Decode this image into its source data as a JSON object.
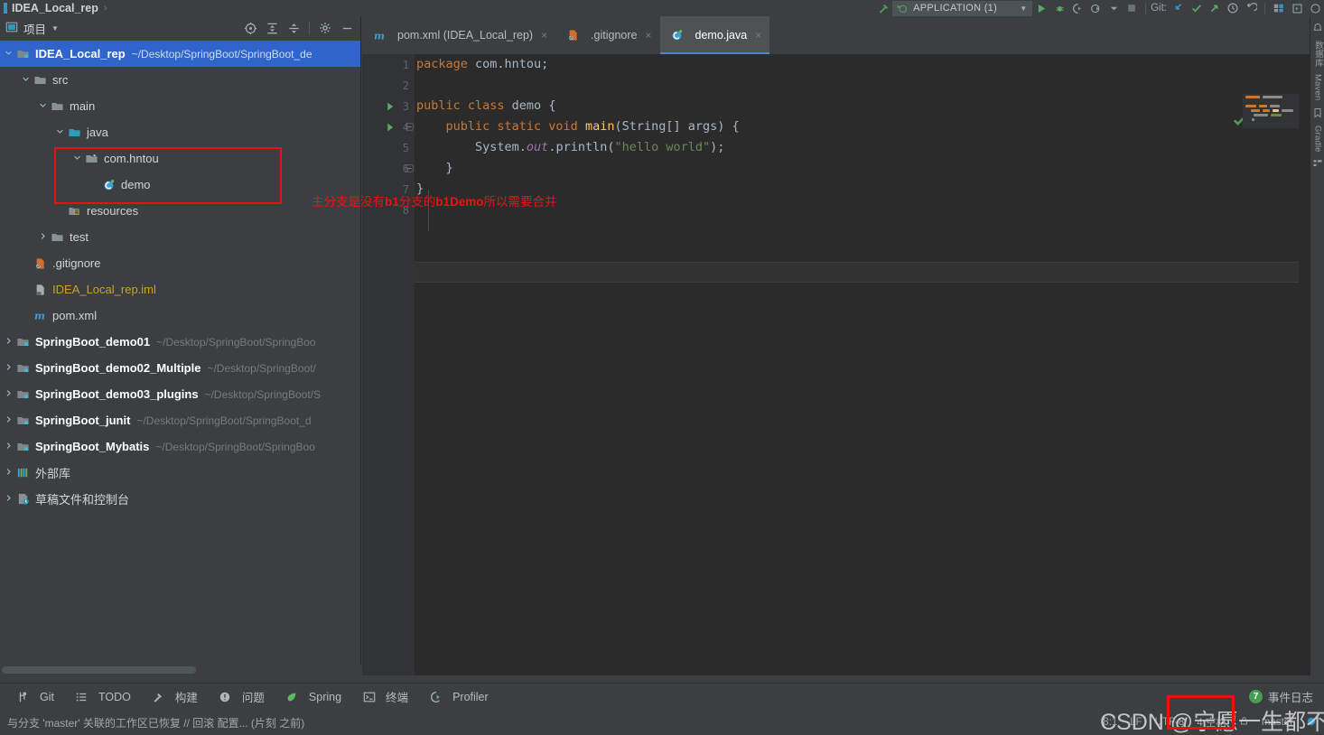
{
  "topbar": {
    "breadcrumb": "IDEA_Local_rep",
    "breadcrumb_sep": "›",
    "run_config": "APPLICATION (1)",
    "run_config_caret": "▼",
    "icons": [
      "hammer-icon",
      "run-config-icon",
      "run-icon",
      "debug-icon",
      "run-with-coverage-icon",
      "profile-icon",
      "stop-icon"
    ],
    "git_label": "Git:",
    "git_icons": [
      "update-project-icon",
      "commit-icon",
      "push-icon",
      "history-icon",
      "rollback-icon"
    ],
    "trailing_icons": [
      "search-everywhere-icon",
      "settings-icon"
    ]
  },
  "project_panel": {
    "title": "项目",
    "caret": "▼",
    "actions": [
      "select-opened-file-icon",
      "expand-all-icon",
      "collapse-all-icon",
      "settings-gear-icon",
      "hide-icon"
    ],
    "tree": [
      {
        "depth": 0,
        "arrow": "down",
        "icon": "module-icon",
        "label": "IDEA_Local_rep",
        "bold": true,
        "path": "~/Desktop/SpringBoot/SpringBoot_de",
        "selected": true
      },
      {
        "depth": 1,
        "arrow": "down",
        "icon": "folder-icon",
        "label": "src",
        "bold": false,
        "path": ""
      },
      {
        "depth": 2,
        "arrow": "down",
        "icon": "folder-icon",
        "label": "main",
        "bold": false,
        "path": ""
      },
      {
        "depth": 3,
        "arrow": "down",
        "icon": "source-root-icon",
        "label": "java",
        "bold": false,
        "path": ""
      },
      {
        "depth": 4,
        "arrow": "down",
        "icon": "package-icon",
        "label": "com.hntou",
        "bold": false,
        "path": ""
      },
      {
        "depth": 5,
        "arrow": "none",
        "icon": "java-class-icon",
        "label": "demo",
        "bold": false,
        "path": ""
      },
      {
        "depth": 3,
        "arrow": "none",
        "icon": "resource-root-icon",
        "label": "resources",
        "bold": false,
        "path": ""
      },
      {
        "depth": 2,
        "arrow": "right",
        "icon": "folder-icon",
        "label": "test",
        "bold": false,
        "path": ""
      },
      {
        "depth": 1,
        "arrow": "none",
        "icon": "gitignore-icon",
        "label": ".gitignore",
        "bold": false,
        "path": ""
      },
      {
        "depth": 1,
        "arrow": "none",
        "icon": "iml-icon",
        "label": "IDEA_Local_rep.iml",
        "bold": false,
        "path": "",
        "yellow": true
      },
      {
        "depth": 1,
        "arrow": "none",
        "icon": "maven-icon",
        "label": "pom.xml",
        "bold": false,
        "path": ""
      },
      {
        "depth": 0,
        "arrow": "right",
        "icon": "module-icon",
        "label": "SpringBoot_demo01",
        "bold": true,
        "path": "~/Desktop/SpringBoot/SpringBoo"
      },
      {
        "depth": 0,
        "arrow": "right",
        "icon": "module-icon",
        "label": "SpringBoot_demo02_Multiple",
        "bold": true,
        "path": "~/Desktop/SpringBoot/"
      },
      {
        "depth": 0,
        "arrow": "right",
        "icon": "module-icon",
        "label": "SpringBoot_demo03_plugins",
        "bold": true,
        "path": "~/Desktop/SpringBoot/S"
      },
      {
        "depth": 0,
        "arrow": "right",
        "icon": "module-icon",
        "label": "SpringBoot_junit",
        "bold": true,
        "path": "~/Desktop/SpringBoot/SpringBoot_d"
      },
      {
        "depth": 0,
        "arrow": "right",
        "icon": "module-icon",
        "label": "SpringBoot_Mybatis",
        "bold": true,
        "path": "~/Desktop/SpringBoot/SpringBoo"
      },
      {
        "depth": 0,
        "arrow": "right",
        "icon": "external-libraries-icon",
        "label": "外部库",
        "bold": false,
        "path": ""
      },
      {
        "depth": 0,
        "arrow": "right",
        "icon": "scratches-icon",
        "label": "草稿文件和控制台",
        "bold": false,
        "path": ""
      }
    ]
  },
  "editor": {
    "tabs": [
      {
        "label": "pom.xml (IDEA_Local_rep)",
        "icon": "maven-icon",
        "active": false,
        "close": "×"
      },
      {
        "label": ".gitignore",
        "icon": "gitignore-icon",
        "active": false,
        "close": "×"
      },
      {
        "label": "demo.java",
        "icon": "java-class-icon",
        "active": true,
        "close": "×"
      }
    ],
    "line_numbers": [
      "1",
      "2",
      "3",
      "4",
      "5",
      "6",
      "7",
      "8"
    ],
    "code_lines": [
      [
        {
          "t": "package ",
          "c": "k"
        },
        {
          "t": "com.hntou;",
          "c": "pl"
        }
      ],
      [],
      [
        {
          "t": "public class ",
          "c": "k"
        },
        {
          "t": "demo ",
          "c": "cls"
        },
        {
          "t": "{",
          "c": "br"
        }
      ],
      [
        {
          "t": "    public static void ",
          "c": "k"
        },
        {
          "t": "main",
          "c": "fn"
        },
        {
          "t": "(",
          "c": "br"
        },
        {
          "t": "String",
          "c": "cls"
        },
        {
          "t": "[] args",
          "c": "pl"
        },
        {
          "t": ") ",
          "c": "br"
        },
        {
          "t": "{",
          "c": "br"
        }
      ],
      [
        {
          "t": "        System.",
          "c": "pl"
        },
        {
          "t": "out",
          "c": "fld"
        },
        {
          "t": ".println",
          "c": "pl"
        },
        {
          "t": "(",
          "c": "br"
        },
        {
          "t": "\"hello world\"",
          "c": "str"
        },
        {
          "t": ");",
          "c": "br"
        }
      ],
      [
        {
          "t": "    }",
          "c": "br"
        }
      ],
      [
        {
          "t": "}",
          "c": "br"
        }
      ],
      []
    ],
    "run_markers": {
      "3": "run-class-gutter-icon",
      "4": "run-method-gutter-icon"
    },
    "fold_markers": {
      "4": "fold-collapse-icon",
      "6": "fold-collapse-icon"
    },
    "inspection_status": "no-errors-checkmark",
    "annotation": {
      "prefix": "主分支是没有",
      "bold1": "b1",
      "middle": "分支的",
      "bold2": "b1Demo",
      "suffix": "所以需要合并"
    }
  },
  "right_strip": {
    "labels": [
      "数据库",
      "Maven",
      "Gradle"
    ],
    "icons": [
      "notifications-icon",
      "bookmarks-icon",
      "structure-icon"
    ]
  },
  "toolwindow_bar": {
    "items": [
      {
        "label": "Git",
        "icon": "git-branch-icon"
      },
      {
        "label": "TODO",
        "icon": "todo-list-icon"
      },
      {
        "label": "构建",
        "icon": "build-hammer-icon"
      },
      {
        "label": "问题",
        "icon": "problems-icon"
      },
      {
        "label": "Spring",
        "icon": "spring-leaf-icon"
      },
      {
        "label": "终端",
        "icon": "terminal-icon"
      },
      {
        "label": "Profiler",
        "icon": "profiler-icon"
      }
    ],
    "event_log": {
      "label": "事件日志",
      "count": "7"
    }
  },
  "statusbar": {
    "message": "与分支 'master' 关联的工作区已恢复 // 回滚   配置... (片刻 之前)",
    "caret_position": "8:1",
    "line_separator": "LF",
    "encoding": "UTF-8",
    "indent": "4 空格",
    "branch": "master",
    "right_icons": [
      "lock-icon",
      "branch-icon",
      "inspections-icon"
    ]
  },
  "watermark": {
    "text": "CSDN @宁愿一生都不说话"
  },
  "colors": {
    "panel_bg": "#3c3f41",
    "editor_bg": "#2b2b2b",
    "selection_blue": "#2f65ca",
    "accent_blue": "#4a88c7",
    "keyword_orange": "#cc7832",
    "string_green": "#6a8759",
    "method_yellow": "#ffc66d",
    "field_purple": "#9876aa",
    "default_text": "#a9b7c6",
    "annotation_red": "#ee1111",
    "badge_green": "#499c54",
    "iml_yellow": "#c9a227"
  }
}
